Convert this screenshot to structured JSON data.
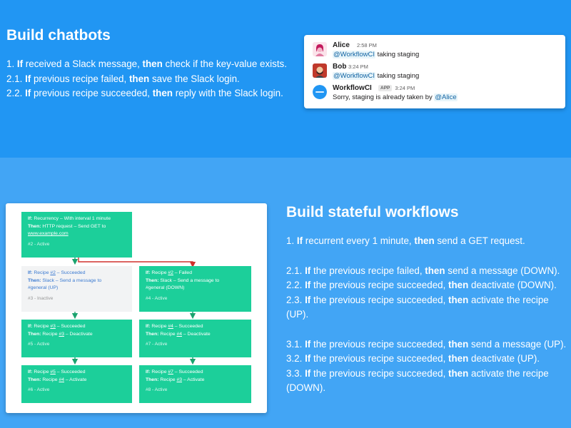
{
  "chatbots": {
    "title": "Build chatbots",
    "rules": [
      {
        "num": "1. ",
        "if": "If",
        "cond": " received a Slack message, ",
        "then": "then",
        "action": " check if the key-value exists."
      },
      {
        "num": "2.1. ",
        "if": "If",
        "cond": " previous recipe failed, ",
        "then": "then",
        "action": " save the Slack login."
      },
      {
        "num": "2.2. ",
        "if": "If",
        "cond": " previous recipe succeeded, ",
        "then": "then",
        "action": " reply with the Slack login."
      }
    ]
  },
  "slack": {
    "messages": [
      {
        "author": "Alice",
        "badge": "",
        "time": "2:58 PM",
        "mention": "@WorkflowCI",
        "text": " taking staging",
        "avatar_color": "#f3b5c8"
      },
      {
        "author": "Bob",
        "badge": "",
        "time": "3:24 PM",
        "mention": "@WorkflowCI",
        "text": " taking staging",
        "avatar_color": "#c0392b"
      },
      {
        "author": "WorkflowCI",
        "badge": "APP",
        "time": "3:24 PM",
        "text": "Sorry, staging is already taken by ",
        "mention": "@Alice",
        "avatar_color": "#2196f3"
      }
    ]
  },
  "stateful": {
    "title": "Build stateful workflows",
    "rules": [
      {
        "num": "1. ",
        "if": "If",
        "cond": " recurrent every 1 minute, ",
        "then": "then",
        "action": " send a GET request."
      },
      {
        "gap": true
      },
      {
        "num": "2.1. ",
        "if": "If",
        "cond": " the previous recipe failed, ",
        "then": "then",
        "action": " send a message (DOWN)."
      },
      {
        "num": "2.2. ",
        "if": "If",
        "cond": " the previous recipe succeeded, ",
        "then": "then",
        "action": " deactivate (DOWN)."
      },
      {
        "num": "2.3. ",
        "if": "If",
        "cond": " the previous recipe succeeded, ",
        "then": "then",
        "action": " activate the recipe (UP)."
      },
      {
        "gap": true
      },
      {
        "num": "3.1. ",
        "if": "If",
        "cond": " the previous recipe succeeded, ",
        "then": "then",
        "action": " send a message (UP)."
      },
      {
        "num": "3.2. ",
        "if": "If",
        "cond": " the previous recipe succeeded, ",
        "then": "then",
        "action": " deactivate (UP)."
      },
      {
        "num": "3.3. ",
        "if": "If",
        "cond": " the previous recipe succeeded, ",
        "then": "then",
        "action": " activate the recipe (DOWN)."
      }
    ]
  },
  "diagram": {
    "nodes": [
      {
        "id": "n1",
        "state": "active",
        "if": "Recurrency – With interval 1 minute",
        "then": "HTTP request – Send GET to",
        "extra_link": "www.example.com",
        "status": "#2 - Active"
      },
      {
        "id": "n2",
        "state": "inactive",
        "if_pre": "Recipe ",
        "if_ref": "#2",
        "if_post": " – Succeeded",
        "then": "Slack – Send a message to",
        "extra": "#general (UP)",
        "status": "#3 - Inactive"
      },
      {
        "id": "n3",
        "state": "active",
        "if_pre": "Recipe ",
        "if_ref": "#2",
        "if_post": " – Failed",
        "then": "Slack – Send a message to",
        "extra": "#general (DOWN)",
        "status": "#4 - Active"
      },
      {
        "id": "n4",
        "state": "active",
        "if_pre": "Recipe ",
        "if_ref": "#3",
        "if_post": " – Succeeded",
        "then_pre": "Recipe ",
        "then_ref": "#3",
        "then_post": " – Deactivate",
        "status": "#5 - Active"
      },
      {
        "id": "n5",
        "state": "active",
        "if_pre": "Recipe ",
        "if_ref": "#4",
        "if_post": " – Succeeded",
        "then_pre": "Recipe ",
        "then_ref": "#4",
        "then_post": " – Deactivate",
        "status": "#7 - Active"
      },
      {
        "id": "n6",
        "state": "active",
        "if_pre": "Recipe ",
        "if_ref": "#5",
        "if_post": " – Succeeded",
        "then_pre": "Recipe ",
        "then_ref": "#4",
        "then_post": " – Activate",
        "status": "#6 - Active"
      },
      {
        "id": "n7",
        "state": "active",
        "if_pre": "Recipe ",
        "if_ref": "#7",
        "if_post": " – Succeeded",
        "then_pre": "Recipe ",
        "then_ref": "#3",
        "then_post": " – Activate",
        "status": "#8 - Active"
      }
    ],
    "labels": {
      "if": "If:",
      "then": "Then:"
    },
    "colors": {
      "active": "#1ccf9a",
      "inactive": "#f2f3f4",
      "arrow_green": "#1aa36e",
      "arrow_red": "#d0312d"
    }
  }
}
